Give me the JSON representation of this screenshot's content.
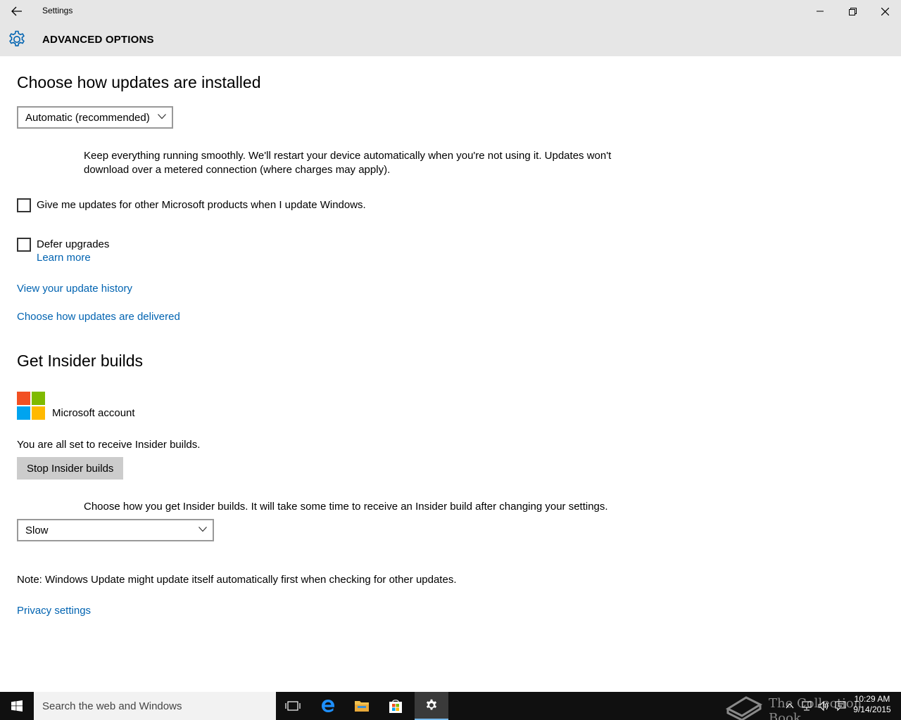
{
  "window": {
    "title": "Settings"
  },
  "header": {
    "title": "ADVANCED OPTIONS",
    "accent_color": "#0063b1"
  },
  "install": {
    "heading": "Choose how updates are installed",
    "selected": "Automatic (recommended)",
    "description": "Keep everything running smoothly. We'll restart your device automatically when you're not using it. Updates won't download over a metered connection (where charges may apply)."
  },
  "options": {
    "other_products_label": "Give me updates for other Microsoft products when I update Windows.",
    "other_products_checked": false,
    "defer_label": "Defer upgrades",
    "defer_checked": false,
    "learn_more": "Learn more"
  },
  "links": {
    "update_history": "View your update history",
    "delivery": "Choose how updates are delivered"
  },
  "insider": {
    "heading": "Get Insider builds",
    "account_label": "Microsoft account",
    "status": "You are all set to receive Insider builds.",
    "stop_button": "Stop Insider builds",
    "choose_text": "Choose how you get Insider builds. It will take some time to receive an Insider build after changing your settings.",
    "ring_selected": "Slow"
  },
  "footer": {
    "note": "Note: Windows Update might update itself automatically first when checking for other updates.",
    "privacy_link": "Privacy settings"
  },
  "taskbar": {
    "search_placeholder": "Search the web and Windows",
    "time": "10:29 AM",
    "date": "9/14/2015",
    "watermark": "The Collection Book"
  }
}
